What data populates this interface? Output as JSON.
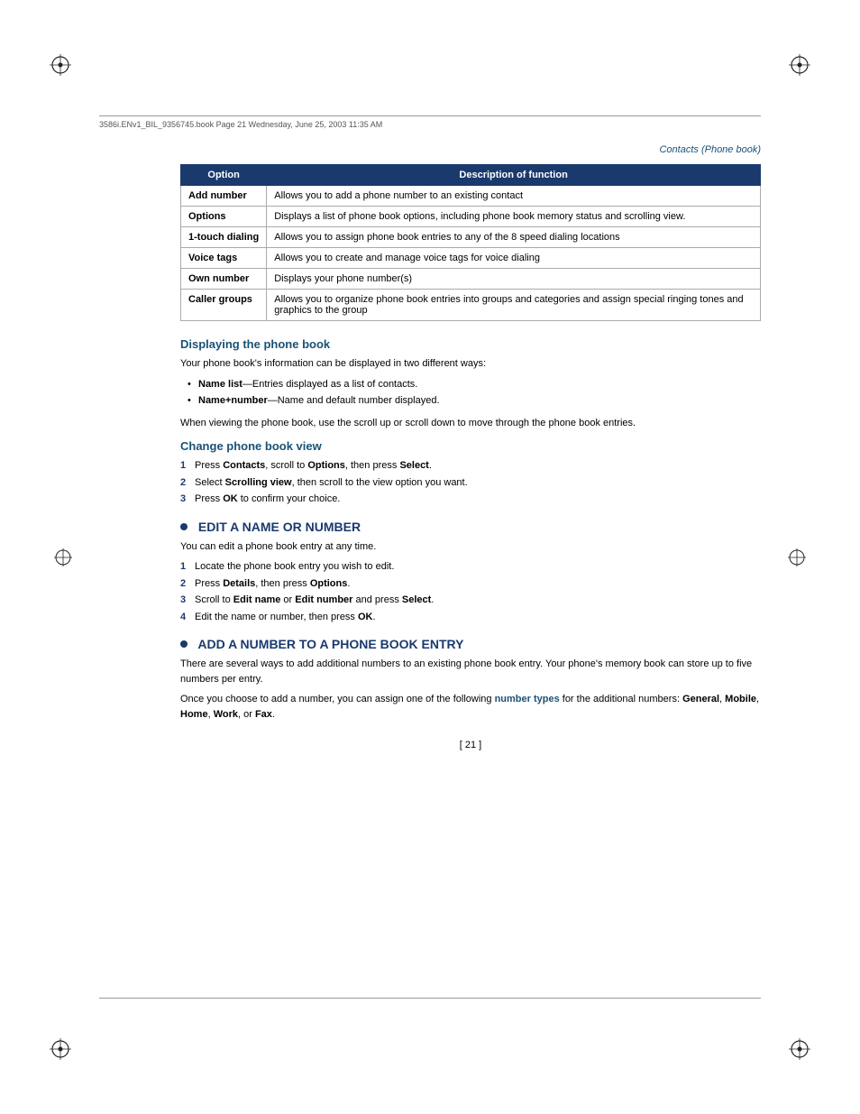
{
  "meta": {
    "header_text": "3586i.ENv1_BIL_9356745.book  Page 21  Wednesday, June 25, 2003  11:35 AM",
    "page_title": "Contacts (Phone book)",
    "page_number": "[ 21 ]"
  },
  "table": {
    "headers": [
      "Option",
      "Description of function"
    ],
    "rows": [
      {
        "option": "Add number",
        "description": "Allows you to add a phone number to an existing contact"
      },
      {
        "option": "Options",
        "description": "Displays a list of phone book options, including phone book memory status and scrolling view."
      },
      {
        "option": "1-touch dialing",
        "description": "Allows you to assign phone book entries to any of the 8 speed dialing locations"
      },
      {
        "option": "Voice tags",
        "description": "Allows you to create and manage voice tags for voice dialing"
      },
      {
        "option": "Own number",
        "description": "Displays your phone number(s)"
      },
      {
        "option": "Caller groups",
        "description": "Allows you to organize phone book entries into groups and categories and assign special ringing tones and graphics to the group"
      }
    ]
  },
  "sections": {
    "displaying": {
      "heading": "Displaying the phone book",
      "intro": "Your phone book's information can be displayed in two different ways:",
      "bullets": [
        {
          "bold": "Name list",
          "text": "—Entries displayed as a list of contacts."
        },
        {
          "bold": "Name+number",
          "text": "—Name and default number displayed."
        }
      ],
      "note": "When viewing the phone book, use the scroll up or scroll down to move through the phone book entries."
    },
    "change_view": {
      "heading": "Change phone book view",
      "steps": [
        {
          "num": "1",
          "text": "Press Contacts, scroll to Options, then press Select."
        },
        {
          "num": "2",
          "text": "Select Scrolling view, then scroll to the view option you want."
        },
        {
          "num": "3",
          "text": "Press OK to confirm your choice."
        }
      ]
    },
    "edit": {
      "heading": "EDIT A NAME OR NUMBER",
      "intro": "You can edit a phone book entry at any time.",
      "steps": [
        {
          "num": "1",
          "text": "Locate the phone book entry you wish to edit."
        },
        {
          "num": "2",
          "text": "Press Details, then press Options."
        },
        {
          "num": "3",
          "text": "Scroll to Edit name or Edit number and press Select."
        },
        {
          "num": "4",
          "text": "Edit the name or number, then press OK."
        }
      ]
    },
    "add_number": {
      "heading": "ADD A NUMBER TO A PHONE BOOK ENTRY",
      "para1": "There are several ways to add additional numbers to an existing phone book entry. Your phone's memory book can store up to five numbers per entry.",
      "para2_prefix": "Once you choose to add a number, you can assign one of the following ",
      "para2_link": "number types",
      "para2_suffix": " for the additional numbers: General, Mobile, Home, Work, or Fax.",
      "bold_items": [
        "General",
        "Mobile",
        "Home",
        "Work",
        "Fax"
      ]
    }
  }
}
